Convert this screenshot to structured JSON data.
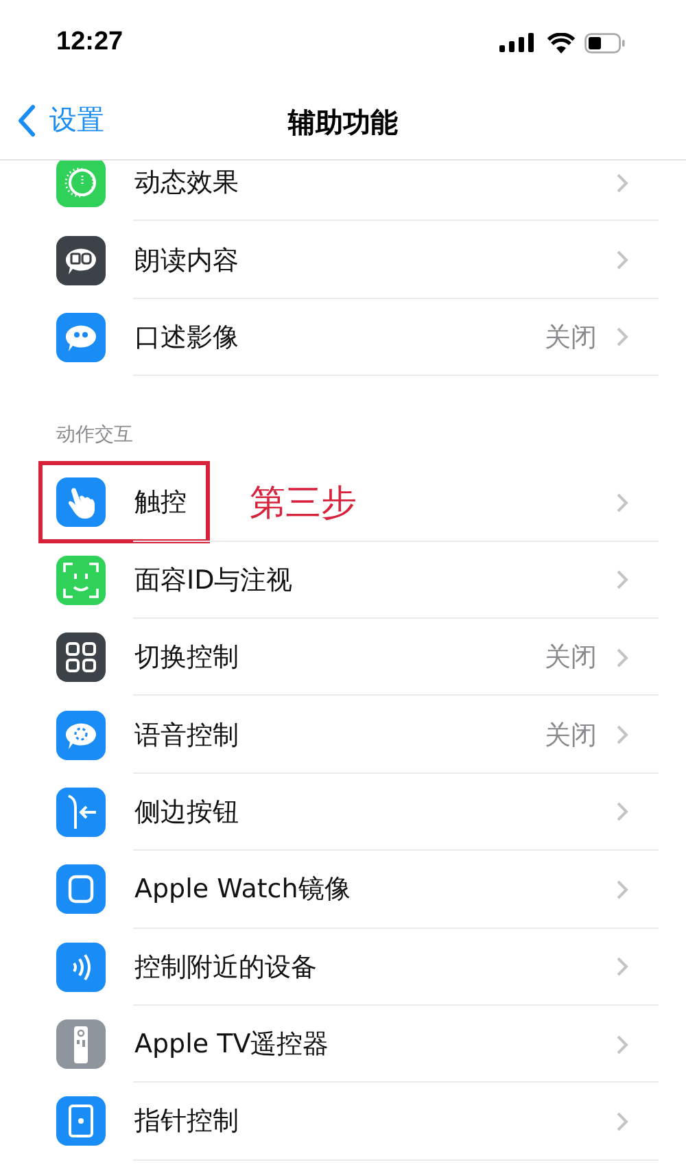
{
  "status_bar": {
    "time": "12:27"
  },
  "nav": {
    "back": "设置",
    "title": "辅助功能"
  },
  "groups": [
    {
      "items": [
        {
          "label": "动态效果",
          "kind": "motion"
        },
        {
          "label": "朗读内容",
          "kind": "speech"
        },
        {
          "label": "口述影像",
          "kind": "quote",
          "value": "关闭"
        }
      ]
    },
    {
      "header": "动作交互",
      "items": [
        {
          "label": "触控",
          "kind": "hand",
          "highlighted": true,
          "annotation": "第三步"
        },
        {
          "label": "面容ID与注视",
          "kind": "face"
        },
        {
          "label": "切换控制",
          "kind": "grid",
          "value": "关闭"
        },
        {
          "label": "语音控制",
          "kind": "voice",
          "value": "关闭"
        },
        {
          "label": "侧边按钮",
          "kind": "side"
        },
        {
          "label": "Apple Watch镜像",
          "kind": "watch"
        },
        {
          "label": "控制附近的设备",
          "kind": "waves"
        },
        {
          "label": "Apple TV遥控器",
          "kind": "remote"
        },
        {
          "label": "指针控制",
          "kind": "pointer"
        }
      ]
    }
  ]
}
